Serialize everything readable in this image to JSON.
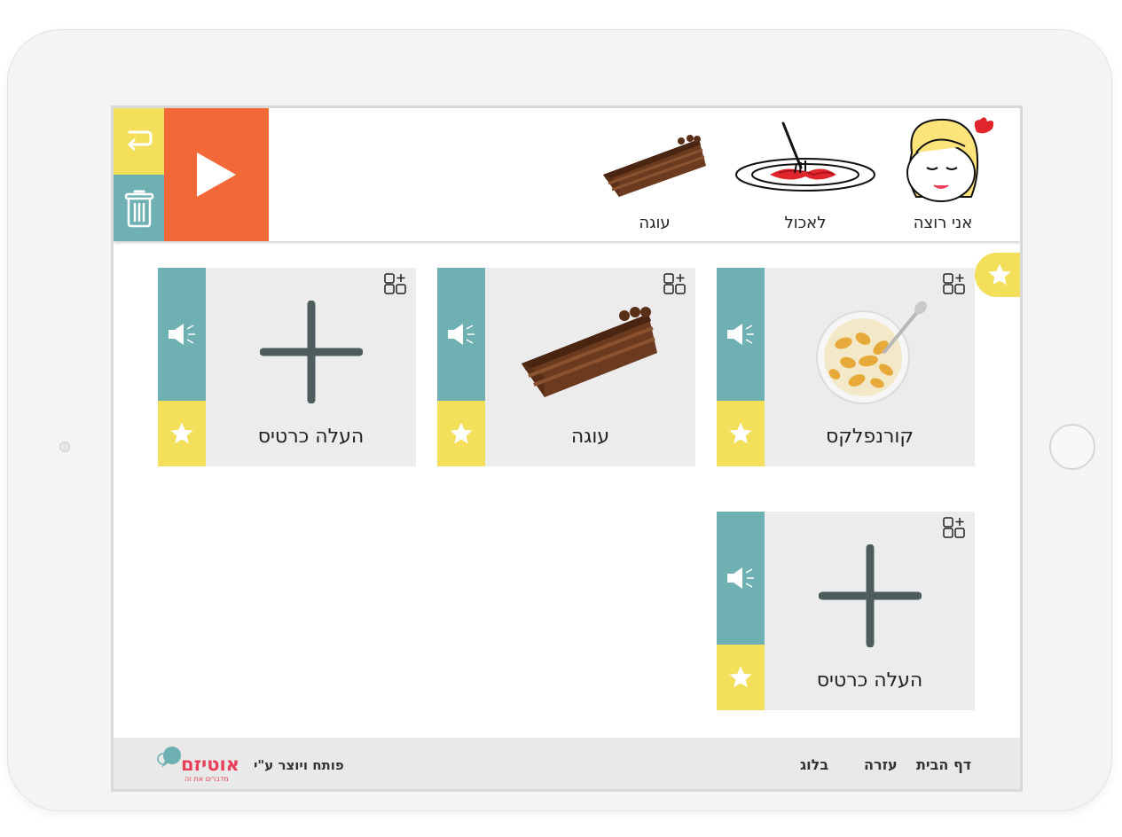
{
  "sentence_strip": {
    "words": [
      {
        "label": "אני רוצה",
        "icon": "girl-face-icon"
      },
      {
        "label": "לאכול",
        "icon": "spaghetti-plate-icon"
      },
      {
        "label": "עוגה",
        "icon": "cake-slice-icon"
      }
    ],
    "controls": {
      "play_icon": "play-icon",
      "undo_icon": "undo-arrow-icon",
      "delete_icon": "trash-icon"
    }
  },
  "cards": [
    {
      "label": "קורנפלקס",
      "image": "cornflakes-bowl-icon"
    },
    {
      "label": "עוגה",
      "image": "cake-slice-icon"
    },
    {
      "label": "העלה כרטיס",
      "image": "plus-icon"
    },
    {
      "label": "העלה כרטיס",
      "image": "plus-icon"
    }
  ],
  "footer": {
    "nav": [
      "דף הבית",
      "עזרה",
      "בלוג"
    ],
    "credit": "פותח ויוצר ע\"י",
    "logo": {
      "name": "אוטיזם",
      "tagline": "מדברים את זה"
    }
  },
  "colors": {
    "teal": "#6fb0b3",
    "yellow": "#f3df5a",
    "orange": "#f26937",
    "card_bg": "#ececec",
    "logo_pink": "#e8405a"
  }
}
